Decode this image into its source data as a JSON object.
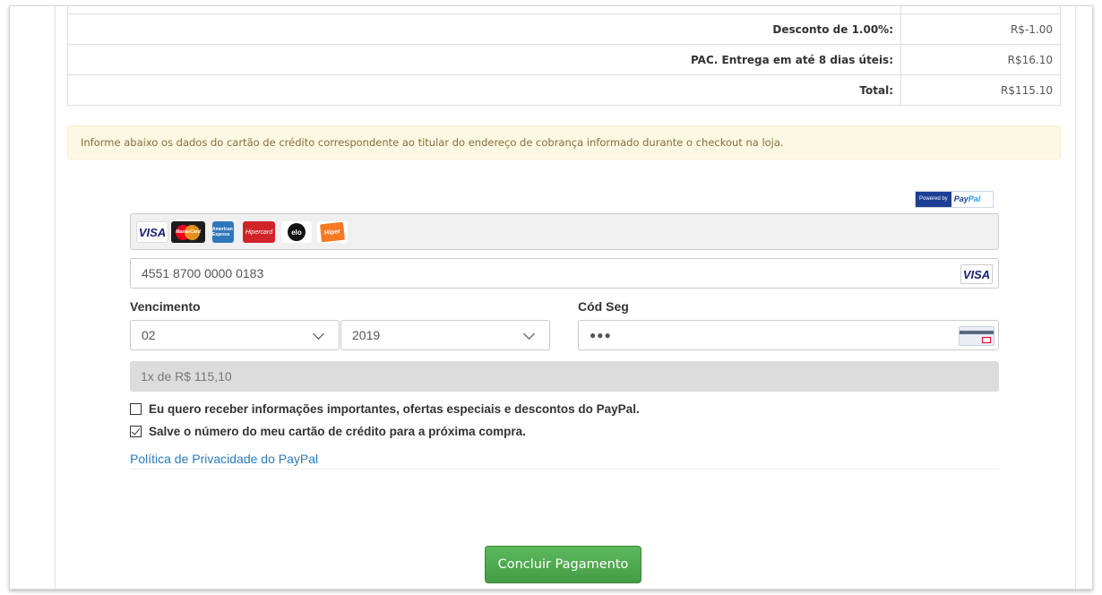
{
  "totals": {
    "rows": [
      {
        "label": "Desconto de 1.00%:",
        "value": "R$-1.00"
      },
      {
        "label": "PAC. Entrega em até 8 dias úteis:",
        "value": "R$16.10"
      },
      {
        "label": "Total:",
        "value": "R$115.10"
      }
    ]
  },
  "alert": {
    "text": "Informe abaixo os dados do cartão de crédito correspondente ao titular do endereço de cobrança informado durante o checkout na loja."
  },
  "paypal_badge": {
    "powered_by": "Powered by",
    "brand_pay": "Pay",
    "brand_pal": "Pal"
  },
  "card_brands": [
    {
      "name": "VISA",
      "icon": "visa-icon"
    },
    {
      "name": "MasterCard",
      "icon": "mastercard-icon"
    },
    {
      "name": "American Express",
      "icon": "amex-icon"
    },
    {
      "name": "Hipercard",
      "icon": "hipercard-icon"
    },
    {
      "name": "elo",
      "icon": "elo-icon"
    },
    {
      "name": "Hiper",
      "icon": "hiper-icon"
    }
  ],
  "card_form": {
    "card_number": "4551 8700 0000 0183",
    "detected_brand": "VISA",
    "expiry_label": "Vencimento",
    "month": "02",
    "year": "2019",
    "cvv_label": "Cód Seg",
    "cvv_masked": "●●●",
    "installments": "1x de R$ 115,10"
  },
  "options": {
    "newsletter_label": "Eu quero receber informações importantes, ofertas especiais e descontos do PayPal.",
    "newsletter_checked": false,
    "save_card_label": "Salve o número do meu cartão de crédito para a próxima compra.",
    "save_card_checked": true
  },
  "privacy_link": "Política de Privacidade do PayPal",
  "submit_label": "Concluir Pagamento",
  "colors": {
    "accent_button": "#5cb85c",
    "alert_bg": "#fcf8e3",
    "link": "#2a7ab8",
    "paypal_blue": "#1c3f94"
  }
}
